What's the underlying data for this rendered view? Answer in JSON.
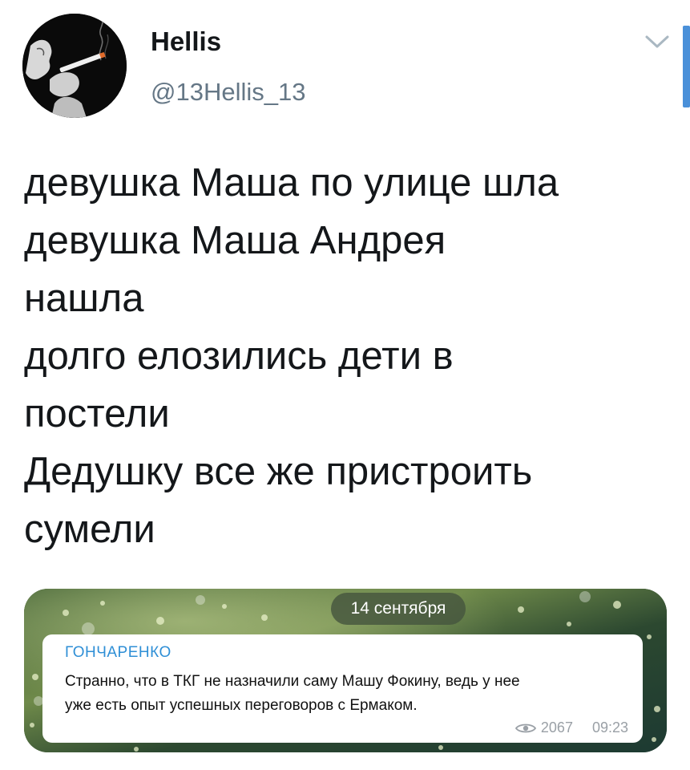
{
  "author": {
    "display_name": "Hellis",
    "handle": "@13Hellis_13"
  },
  "icons": {
    "menu": "chevron-down-icon",
    "views": "eye-icon"
  },
  "colors": {
    "text": "#14171a",
    "secondary": "#657786",
    "accent": "#4a90d9",
    "telegram_sender": "#2f8fd6"
  },
  "tweet": {
    "lines": [
      "девушка Маша по улице шла",
      "девушка Маша Андрея",
      "нашла",
      "долго елозились дети в",
      "постели",
      "Дедушку все же пристроить",
      "сумели"
    ]
  },
  "media": {
    "date_badge": "14 сентября",
    "message": {
      "sender": "ГОНЧАРЕНКО",
      "text_line_1": "Странно, что в ТКГ не назначили саму Машу Фокину, ведь у нее",
      "text_line_2": "уже есть опыт успешных переговоров с Ермаком.",
      "views": "2067",
      "time": "09:23"
    }
  }
}
